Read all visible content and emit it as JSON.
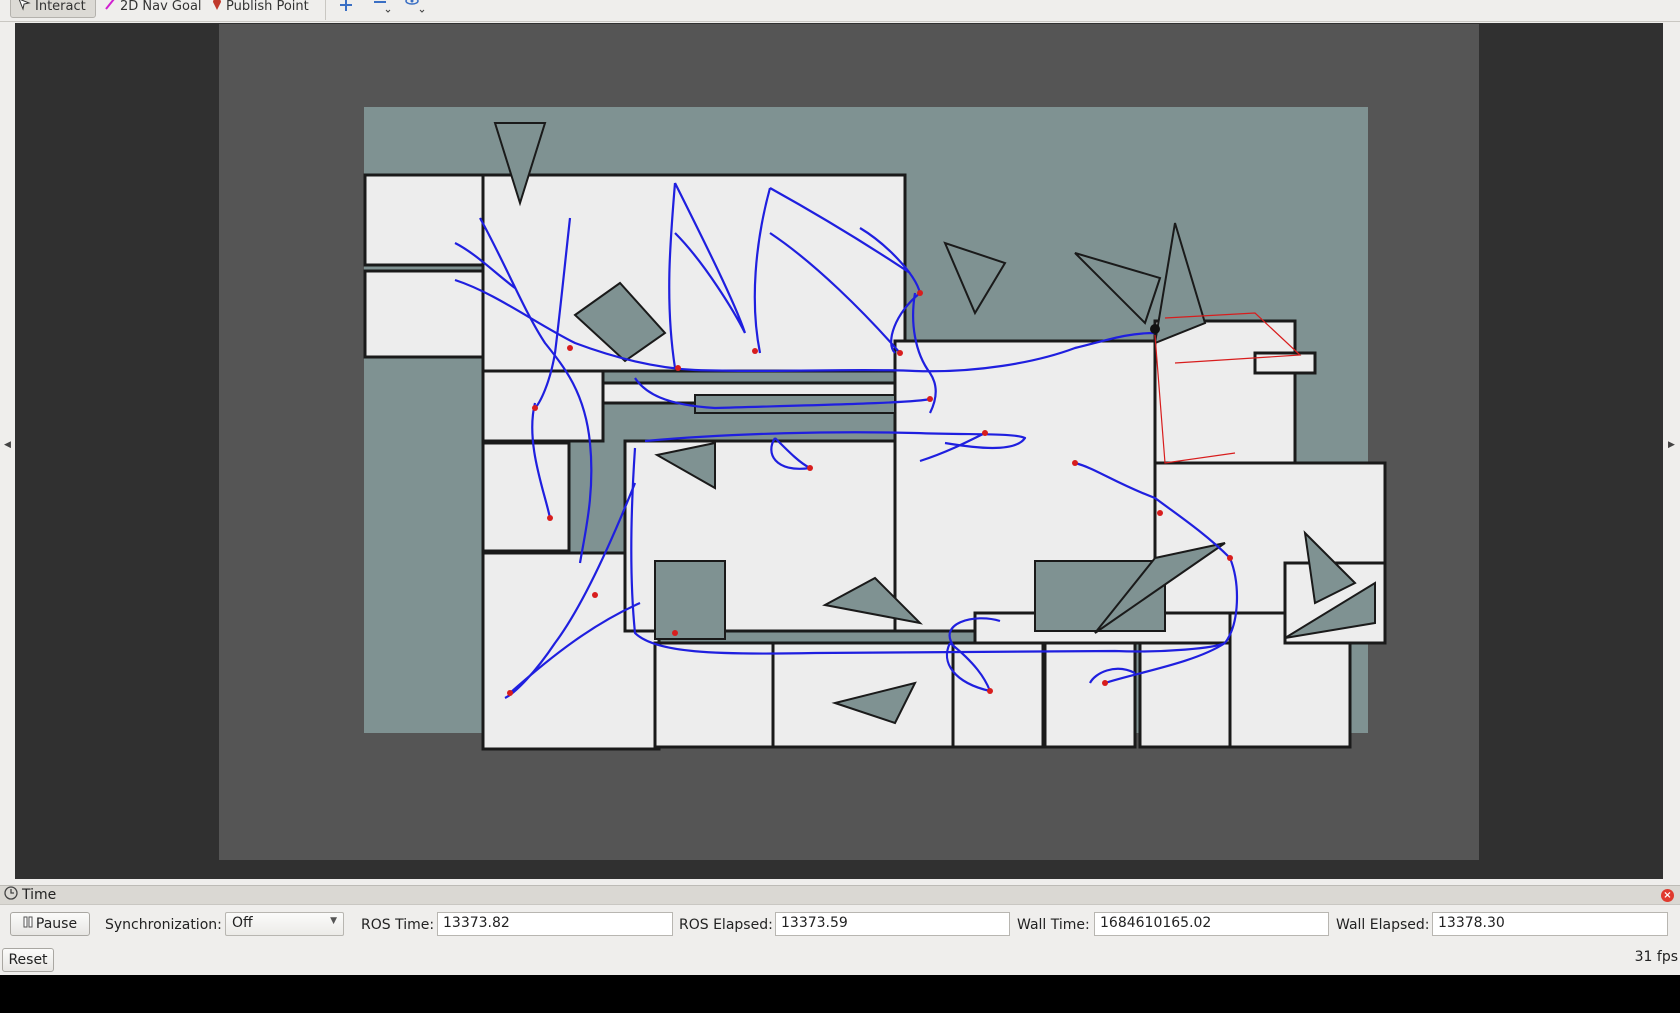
{
  "toolbar": {
    "interact_label": "Interact",
    "nav_goal_label": "2D Nav Goal",
    "publish_point_label": "Publish Point",
    "tools": [
      "move-camera-icon",
      "select-icon",
      "eye-camera-icon"
    ]
  },
  "viewport": {
    "background_color": "#303030",
    "map_free_color": "#efefef",
    "map_unknown_color": "#7f9292",
    "path_color": "#1f1fdf",
    "pose_color": "#d81d1d"
  },
  "time_panel": {
    "title": "Time",
    "pause_label": "Pause",
    "sync_label": "Synchronization:",
    "sync_value": "Off",
    "ros_time_label": "ROS Time:",
    "ros_time_value": "13373.82",
    "ros_elapsed_label": "ROS Elapsed:",
    "ros_elapsed_value": "13373.59",
    "wall_time_label": "Wall Time:",
    "wall_time_value": "1684610165.02",
    "wall_elapsed_label": "Wall Elapsed:",
    "wall_elapsed_value": "13378.30",
    "reset_label": "Reset"
  },
  "status": {
    "fps": "31 fps"
  }
}
